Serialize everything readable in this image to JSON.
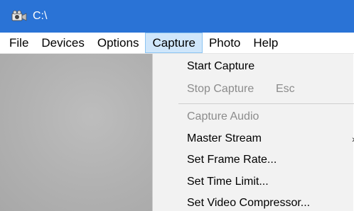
{
  "window": {
    "title": "C:\\",
    "icon": "camera-icon",
    "title_color": "#2a73d6"
  },
  "menubar": {
    "items": [
      {
        "label": "File"
      },
      {
        "label": "Devices"
      },
      {
        "label": "Options"
      },
      {
        "label": "Capture",
        "active": true
      },
      {
        "label": "Photo"
      },
      {
        "label": "Help"
      }
    ]
  },
  "capture_menu": {
    "start_capture": "Start Capture",
    "stop_capture": "Stop Capture",
    "stop_capture_shortcut": "Esc",
    "capture_audio": "Capture Audio",
    "master_stream": "Master Stream",
    "set_frame_rate": "Set Frame Rate...",
    "set_time_limit": "Set Time Limit...",
    "set_video_compressor": "Set Video Compressor..."
  }
}
